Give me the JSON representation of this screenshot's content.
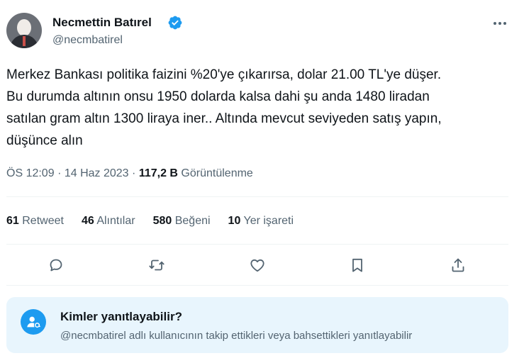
{
  "author": {
    "display_name": "Necmettin Batırel",
    "handle": "@necmbatirel",
    "verified_color": "#1d9bf0"
  },
  "tweet": {
    "lines": [
      "Merkez Bankası politika faizini %20'ye çıkarırsa, dolar 21.00 TL'ye düşer.",
      "Bu durumda altının onsu 1950 dolarda kalsa dahi şu anda 1480 liradan",
      "satılan gram altın 1300 liraya iner.. Altında mevcut seviyeden satış yapın,",
      "düşünce alın"
    ]
  },
  "meta": {
    "time": "ÖS 12:09",
    "separator": "·",
    "date": "14 Haz 2023",
    "views_count": "117,2 B",
    "views_label": "Görüntülenme"
  },
  "stats": [
    {
      "count": "61",
      "label": "Retweet"
    },
    {
      "count": "46",
      "label": "Alıntılar"
    },
    {
      "count": "580",
      "label": "Beğeni"
    },
    {
      "count": "10",
      "label": "Yer işareti"
    }
  ],
  "actions": {
    "icons": [
      "reply-icon",
      "retweet-icon",
      "like-icon",
      "bookmark-icon",
      "share-icon"
    ],
    "icon_color": "#536471"
  },
  "reply_restriction": {
    "title": "Kimler yanıtlayabilir?",
    "subtitle": "@necmbatirel adlı kullanıcının takip ettikleri veya bahsettikleri yanıtlayabilir",
    "background": "#e8f5fd",
    "accent": "#1d9bf0"
  }
}
